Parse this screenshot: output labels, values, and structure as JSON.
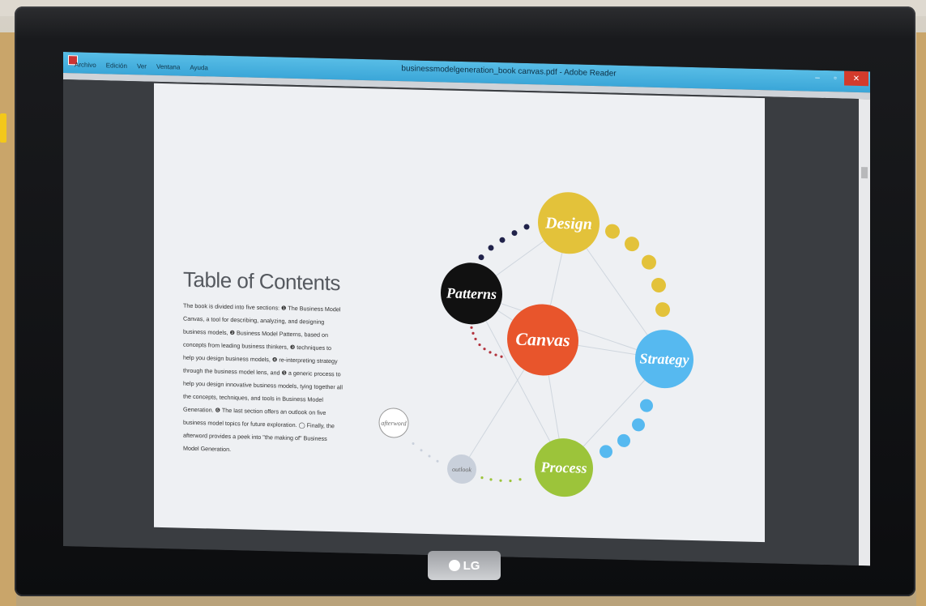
{
  "window": {
    "title": "businessmodelgeneration_book canvas.pdf - Adobe Reader",
    "menu": [
      "Archivo",
      "Edición",
      "Ver",
      "Ventana",
      "Ayuda"
    ],
    "buttons": {
      "minimize": "–",
      "maximize": "▫",
      "close": "✕"
    }
  },
  "page": {
    "toc_title": "Table of Contents",
    "toc_text": "The book is divided into five sections: ❶ The Business Model Canvas, a tool for describing, analyzing, and designing business models, ❷ Business Model Patterns, based on concepts from leading business thinkers, ❸ techniques to help you design business models, ❹ re-interpreting strategy through the business model lens, and ❺ a generic process to help you design innovative business models, tying together all the concepts, techniques, and tools in Business Model Generation. ❻ The last section offers an outlook on five business model topics for future exploration. ◯ Finally, the afterword provides a peek into \"the making of\" Business Model Generation."
  },
  "diagram": {
    "nodes": {
      "design": "Design",
      "patterns": "Patterns",
      "canvas": "Canvas",
      "strategy": "Strategy",
      "process": "Process",
      "outlook": "outlook",
      "afterword": "afterword"
    },
    "colors": {
      "design": "#e3c23a",
      "patterns": "#111111",
      "canvas": "#e8552c",
      "strategy": "#56b9f0",
      "process": "#9cc43a",
      "outlook": "#c9d0db",
      "afterword": "#ffffff",
      "patterns_dots": "#20224a",
      "canvas_dots": "#b2323c"
    }
  },
  "monitor": {
    "brand": "LG"
  }
}
